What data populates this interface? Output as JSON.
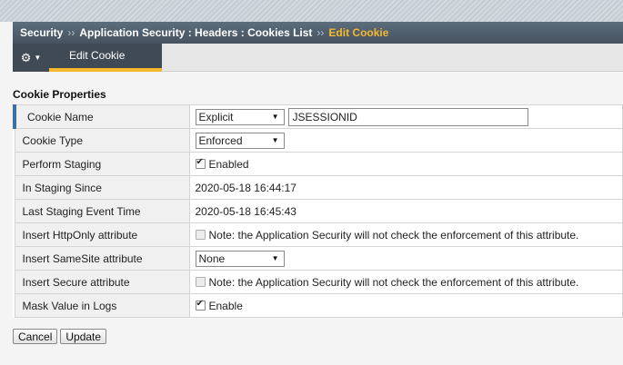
{
  "breadcrumb": {
    "items": [
      "Security",
      "Application Security : Headers : Cookies List"
    ],
    "current": "Edit Cookie",
    "separator": "››"
  },
  "toolbar": {
    "gear_icon": "gear-icon",
    "active_tab": "Edit Cookie"
  },
  "section": {
    "title": "Cookie Properties"
  },
  "properties": {
    "cookie_name": {
      "label": "Cookie Name",
      "type_value": "Explicit",
      "name_value": "JSESSIONID"
    },
    "cookie_type": {
      "label": "Cookie Type",
      "value": "Enforced"
    },
    "perform_staging": {
      "label": "Perform Staging",
      "checked": true,
      "text": "Enabled"
    },
    "in_staging_since": {
      "label": "In Staging Since",
      "value": "2020-05-18 16:44:17"
    },
    "last_staging_event": {
      "label": "Last Staging Event Time",
      "value": "2020-05-18 16:45:43"
    },
    "httponly": {
      "label": "Insert HttpOnly attribute",
      "checked": false,
      "note": "Note: the Application Security will not check the enforcement of this attribute."
    },
    "samesite": {
      "label": "Insert SameSite attribute",
      "value": "None"
    },
    "secure": {
      "label": "Insert Secure attribute",
      "checked": false,
      "note": "Note: the Application Security will not check the enforcement of this attribute."
    },
    "mask_value": {
      "label": "Mask Value in Logs",
      "checked": true,
      "text": "Enable"
    }
  },
  "buttons": {
    "cancel": "Cancel",
    "update": "Update"
  },
  "colors": {
    "accent": "#f5b82e",
    "header": "#46525f",
    "row_marker": "#3b6fa8"
  }
}
